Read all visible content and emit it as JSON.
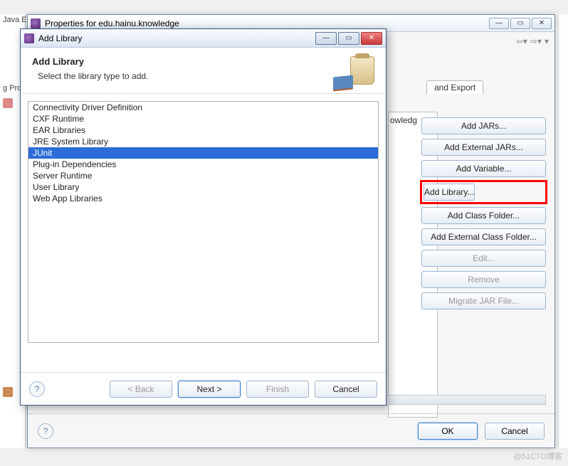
{
  "left_strip": {
    "label1": "Java E",
    "label2": "g Pro"
  },
  "properties_window": {
    "title": "Properties for edu.hainu.knowledge",
    "tab_label": "and Export",
    "list_fragment": "owledg",
    "buttons": {
      "add_jars": "Add JARs...",
      "add_ext_jars": "Add External JARs...",
      "add_variable": "Add Variable...",
      "add_library": "Add Library...",
      "add_class_folder": "Add Class Folder...",
      "add_ext_class_folder": "Add External Class Folder...",
      "edit": "Edit...",
      "remove": "Remove",
      "migrate_jar": "Migrate JAR File..."
    },
    "footer": {
      "ok": "OK",
      "cancel": "Cancel"
    }
  },
  "dialog": {
    "title": "Add Library",
    "heading": "Add Library",
    "subtitle": "Select the library type to add.",
    "items": [
      "Connectivity Driver Definition",
      "CXF Runtime",
      "EAR Libraries",
      "JRE System Library",
      "JUnit",
      "Plug-in Dependencies",
      "Server Runtime",
      "User Library",
      "Web App Libraries"
    ],
    "selected_index": 4,
    "buttons": {
      "back": "< Back",
      "next": "Next >",
      "finish": "Finish",
      "cancel": "Cancel"
    }
  },
  "watermark": "@51CTO博客"
}
